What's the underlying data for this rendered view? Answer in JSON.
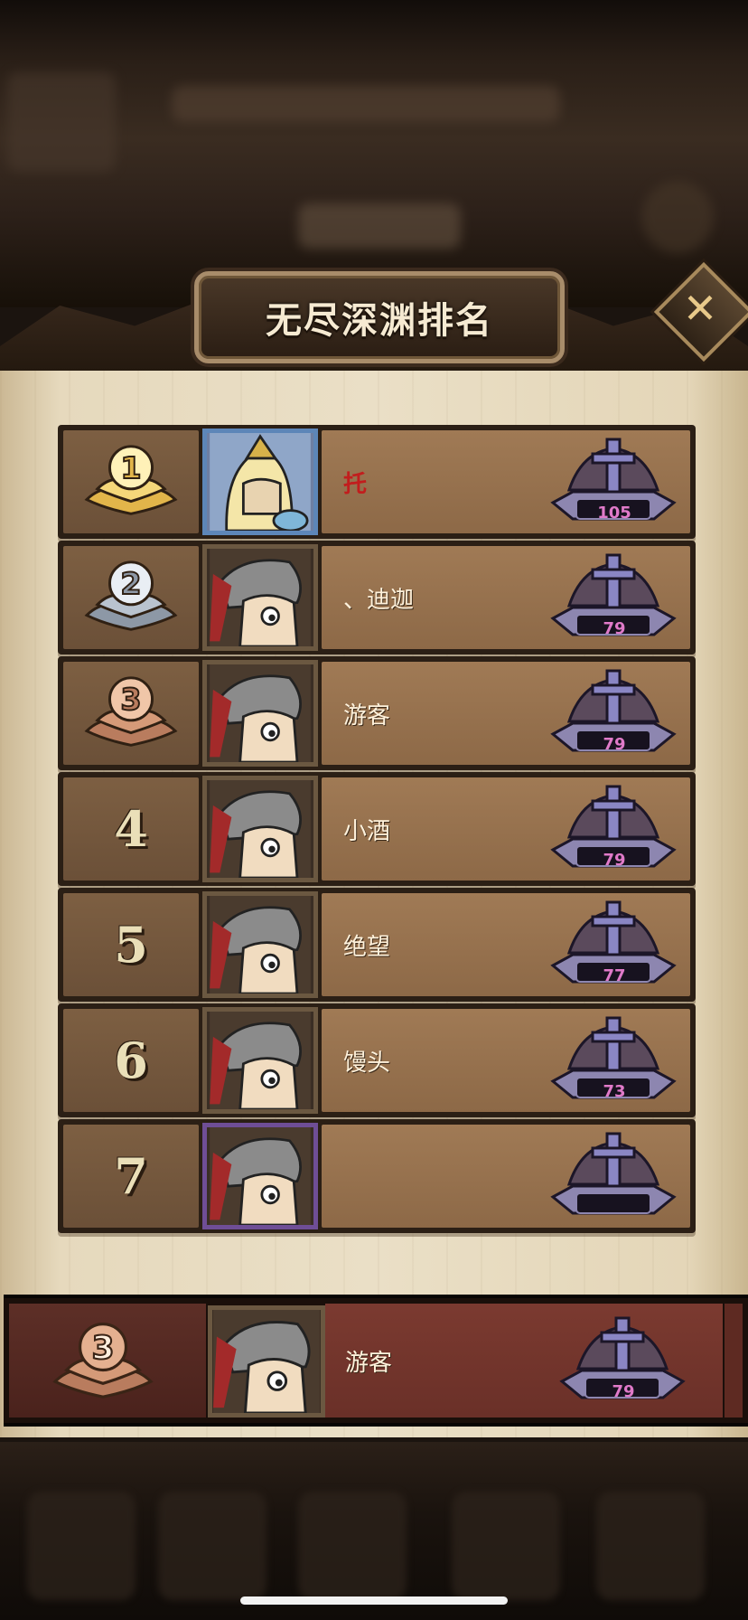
{
  "title": "无尽深渊排名",
  "close_icon": "close-icon",
  "colors": {
    "top_name": "#c21d1d",
    "badge_number": "#e07ac9",
    "gold_medal": "#e2b54a",
    "silver_medal": "#b9c3cf",
    "bronze_medal": "#d59a78"
  },
  "rankings": [
    {
      "rank": "1",
      "name": "托",
      "score": "105"
    },
    {
      "rank": "2",
      "name": "、迪迦",
      "score": "79"
    },
    {
      "rank": "3",
      "name": "游客",
      "score": "79"
    },
    {
      "rank": "4",
      "name": "小酒",
      "score": "79"
    },
    {
      "rank": "5",
      "name": "绝望",
      "score": "77"
    },
    {
      "rank": "6",
      "name": "馒头",
      "score": "73"
    },
    {
      "rank": "7",
      "name": "",
      "score": ""
    }
  ],
  "self": {
    "rank": "3",
    "name": "游客",
    "score": "79"
  }
}
